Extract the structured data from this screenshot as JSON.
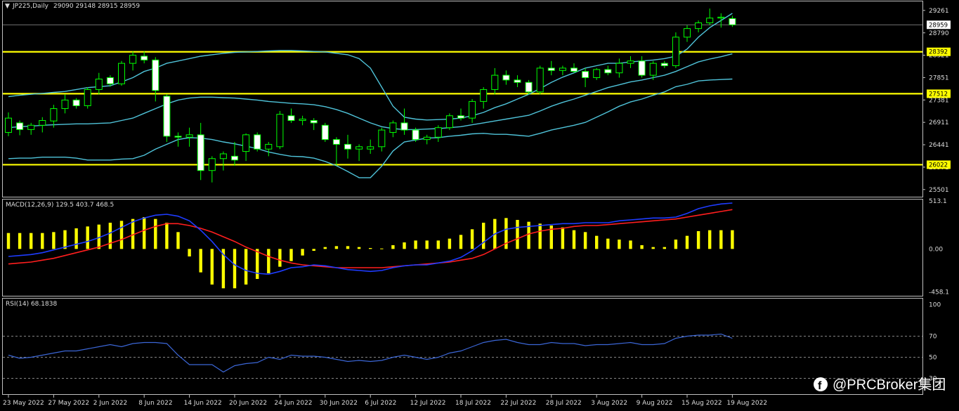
{
  "header": {
    "symbol_label": "JP225,Daily",
    "ohlc_label": "29090 29148 28915 28959"
  },
  "colors": {
    "background": "#000000",
    "grid": "#c0c0c0",
    "candle_up": "#000000",
    "candle_down": "#ffffff",
    "candle_outline": "#00ff00",
    "band": "#4fc3d9",
    "level_line": "#ffff00",
    "macd_hist": "#ffff00",
    "macd_line": "#1e3cff",
    "signal_line": "#ff1e1e",
    "rsi_line": "#3b66d6",
    "price_tag_bg": "#ffffff",
    "level_tag_bg": "#ffff00"
  },
  "watermark": {
    "icon": "facebook-icon",
    "text": "@PRCBroker集团"
  },
  "chart_data": [
    {
      "type": "candlestick",
      "title": "JP225,Daily",
      "ylim": [
        25350,
        29450
      ],
      "price_axis_ticks": [
        "29261",
        "28790",
        "28321",
        "27851",
        "27381",
        "26911",
        "26441",
        "25971",
        "25501"
      ],
      "current_price": "28959",
      "levels": [
        {
          "value": 28392,
          "label": "28392"
        },
        {
          "value": 27512,
          "label": "27512"
        },
        {
          "value": 26022,
          "label": "26022"
        }
      ],
      "x_labels": [
        "23 May 2022",
        "27 May 2022",
        "2 Jun 2022",
        "8 Jun 2022",
        "14 Jun 2022",
        "20 Jun 2022",
        "24 Jun 2022",
        "30 Jun 2022",
        "6 Jul 2022",
        "12 Jul 2022",
        "18 Jul 2022",
        "22 Jul 2022",
        "28 Jul 2022",
        "3 Aug 2022",
        "9 Aug 2022",
        "15 Aug 2022",
        "19 Aug 2022"
      ],
      "x_label_index": [
        0,
        4,
        8,
        12,
        16,
        20,
        24,
        28,
        32,
        36,
        40,
        44,
        48,
        52,
        56,
        60,
        64
      ],
      "candles": [
        [
          26700,
          27120,
          26620,
          27000
        ],
        [
          26900,
          26950,
          26640,
          26760
        ],
        [
          26760,
          26900,
          26650,
          26850
        ],
        [
          26850,
          27020,
          26700,
          26950
        ],
        [
          26940,
          27280,
          26800,
          27200
        ],
        [
          27200,
          27500,
          27100,
          27380
        ],
        [
          27380,
          27420,
          27200,
          27260
        ],
        [
          27260,
          27650,
          27200,
          27600
        ],
        [
          27600,
          27950,
          27500,
          27820
        ],
        [
          27850,
          27900,
          27660,
          27720
        ],
        [
          27720,
          28200,
          27680,
          28150
        ],
        [
          28150,
          28400,
          28000,
          28320
        ],
        [
          28300,
          28400,
          28150,
          28220
        ],
        [
          28220,
          28280,
          27350,
          27580
        ],
        [
          27460,
          27500,
          26500,
          26620
        ],
        [
          26620,
          26700,
          26400,
          26600
        ],
        [
          26600,
          26800,
          26400,
          26650
        ],
        [
          26650,
          26900,
          25700,
          25900
        ],
        [
          25900,
          26200,
          25650,
          26150
        ],
        [
          26150,
          26300,
          25900,
          26250
        ],
        [
          26200,
          26500,
          26000,
          26120
        ],
        [
          26300,
          26680,
          26100,
          26650
        ],
        [
          26650,
          26700,
          26300,
          26350
        ],
        [
          26350,
          26500,
          26200,
          26450
        ],
        [
          26400,
          27150,
          26350,
          27080
        ],
        [
          27050,
          27200,
          26900,
          26950
        ],
        [
          26950,
          27050,
          26850,
          26980
        ],
        [
          26950,
          27000,
          26750,
          26900
        ],
        [
          26850,
          26900,
          26500,
          26550
        ],
        [
          26550,
          26600,
          26000,
          26450
        ],
        [
          26450,
          26650,
          26150,
          26350
        ],
        [
          26350,
          26450,
          26100,
          26400
        ],
        [
          26350,
          26550,
          26250,
          26400
        ],
        [
          26400,
          26800,
          26300,
          26750
        ],
        [
          26700,
          26950,
          26600,
          26900
        ],
        [
          26900,
          27200,
          26650,
          26750
        ],
        [
          26750,
          26800,
          26500,
          26550
        ],
        [
          26550,
          26650,
          26450,
          26600
        ],
        [
          26600,
          26850,
          26500,
          26800
        ],
        [
          26800,
          27100,
          26750,
          27050
        ],
        [
          27050,
          27200,
          26950,
          27000
        ],
        [
          27000,
          27400,
          26900,
          27350
        ],
        [
          27350,
          27650,
          27200,
          27600
        ],
        [
          27600,
          28050,
          27500,
          27900
        ],
        [
          27900,
          28000,
          27700,
          27800
        ],
        [
          27800,
          27900,
          27650,
          27750
        ],
        [
          27750,
          27800,
          27500,
          27550
        ],
        [
          27550,
          28100,
          27500,
          28050
        ],
        [
          28050,
          28200,
          27900,
          28000
        ],
        [
          28000,
          28100,
          27900,
          28050
        ],
        [
          28050,
          28150,
          27950,
          27980
        ],
        [
          27980,
          28050,
          27650,
          27850
        ],
        [
          27850,
          28050,
          27800,
          28020
        ],
        [
          28020,
          28100,
          27900,
          27950
        ],
        [
          27950,
          28250,
          27850,
          28150
        ],
        [
          28150,
          28300,
          28050,
          28200
        ],
        [
          28200,
          28300,
          27850,
          27900
        ],
        [
          27900,
          28200,
          27800,
          28150
        ],
        [
          28150,
          28200,
          28050,
          28100
        ],
        [
          28100,
          28800,
          28050,
          28700
        ],
        [
          28700,
          28950,
          28600,
          28880
        ],
        [
          28880,
          29050,
          28800,
          29000
        ],
        [
          29000,
          29300,
          28950,
          29100
        ],
        [
          29100,
          29200,
          28900,
          29120
        ],
        [
          29090,
          29148,
          28915,
          28959
        ]
      ],
      "bollinger": {
        "upper": [
          27450,
          27480,
          27500,
          27520,
          27540,
          27560,
          27600,
          27640,
          27660,
          27680,
          27760,
          27850,
          27980,
          28050,
          28150,
          28200,
          28250,
          28300,
          28330,
          28360,
          28380,
          28390,
          28400,
          28410,
          28420,
          28420,
          28410,
          28400,
          28390,
          28360,
          28330,
          28250,
          28050,
          27650,
          27250,
          27020,
          26980,
          26960,
          26970,
          26980,
          27000,
          27050,
          27120,
          27220,
          27300,
          27400,
          27500,
          27620,
          27750,
          27860,
          27950,
          28050,
          28100,
          28150,
          28150,
          28180,
          28200,
          28220,
          28250,
          28300,
          28450,
          28700,
          28900,
          29050,
          29200
        ],
        "middle": [
          26800,
          26820,
          26830,
          26850,
          26860,
          26870,
          26880,
          26880,
          26890,
          26900,
          26950,
          27000,
          27100,
          27200,
          27300,
          27380,
          27420,
          27440,
          27440,
          27430,
          27420,
          27400,
          27380,
          27350,
          27330,
          27310,
          27300,
          27280,
          27240,
          27180,
          27100,
          27000,
          26900,
          26820,
          26780,
          26760,
          26760,
          26770,
          26780,
          26800,
          26820,
          26860,
          26900,
          26940,
          26980,
          27020,
          27060,
          27150,
          27250,
          27330,
          27400,
          27480,
          27560,
          27640,
          27700,
          27760,
          27800,
          27850,
          27900,
          27980,
          28080,
          28180,
          28240,
          28290,
          28350
        ],
        "lower": [
          26150,
          26160,
          26160,
          26180,
          26180,
          26180,
          26160,
          26120,
          26120,
          26120,
          26140,
          26150,
          26220,
          26350,
          26450,
          26550,
          26590,
          26580,
          26550,
          26500,
          26460,
          26410,
          26360,
          26290,
          26240,
          26200,
          26190,
          26160,
          26090,
          26000,
          25880,
          25750,
          25750,
          25990,
          26310,
          26500,
          26540,
          26580,
          26590,
          26620,
          26640,
          26670,
          26680,
          26660,
          26660,
          26640,
          26620,
          26680,
          26750,
          26800,
          26850,
          26910,
          27020,
          27130,
          27250,
          27340,
          27400,
          27480,
          27550,
          27660,
          27710,
          27780,
          27800,
          27810,
          27820
        ]
      }
    },
    {
      "type": "bar",
      "title": "MACD(12,26,9) 129.5 403.7 468.5",
      "ylim": [
        -500,
        520
      ],
      "axis_ticks": [
        "513.1",
        "0.00",
        "-458.1"
      ],
      "histogram": [
        170,
        170,
        170,
        170,
        180,
        200,
        220,
        240,
        260,
        280,
        300,
        320,
        340,
        320,
        280,
        180,
        -80,
        -250,
        -380,
        -420,
        -420,
        -380,
        -320,
        -260,
        -190,
        -130,
        -70,
        -20,
        20,
        30,
        30,
        20,
        10,
        5,
        40,
        70,
        90,
        90,
        90,
        110,
        150,
        210,
        280,
        320,
        330,
        310,
        290,
        270,
        250,
        230,
        200,
        180,
        140,
        110,
        100,
        90,
        40,
        20,
        20,
        100,
        140,
        190,
        200,
        200,
        200
      ],
      "macd": [
        -80,
        -70,
        -60,
        -40,
        -10,
        20,
        50,
        80,
        120,
        170,
        230,
        290,
        330,
        360,
        370,
        350,
        300,
        200,
        80,
        -60,
        -170,
        -230,
        -260,
        -270,
        -240,
        -200,
        -190,
        -170,
        -180,
        -200,
        -220,
        -230,
        -240,
        -230,
        -200,
        -180,
        -170,
        -170,
        -150,
        -130,
        -90,
        -20,
        70,
        160,
        210,
        230,
        240,
        250,
        260,
        270,
        270,
        280,
        280,
        280,
        300,
        310,
        320,
        330,
        330,
        340,
        380,
        430,
        460,
        480,
        490
      ],
      "signal": [
        -160,
        -150,
        -140,
        -120,
        -100,
        -70,
        -40,
        -10,
        20,
        60,
        100,
        150,
        200,
        240,
        270,
        270,
        250,
        220,
        180,
        130,
        80,
        20,
        -30,
        -80,
        -120,
        -150,
        -170,
        -180,
        -190,
        -200,
        -200,
        -200,
        -200,
        -200,
        -190,
        -180,
        -170,
        -160,
        -150,
        -140,
        -120,
        -100,
        -60,
        0,
        60,
        110,
        160,
        190,
        210,
        220,
        240,
        250,
        250,
        260,
        270,
        280,
        290,
        300,
        310,
        320,
        340,
        360,
        380,
        400,
        420
      ]
    },
    {
      "type": "line",
      "title": "RSI(14) 68.1838",
      "ylim": [
        15,
        105
      ],
      "axis_ticks": [
        "100",
        "70",
        "50",
        "30"
      ],
      "reference_levels": [
        70,
        50,
        30
      ],
      "values": [
        52,
        49,
        50,
        52,
        54,
        56,
        56,
        58,
        60,
        62,
        60,
        63,
        64,
        64,
        63,
        52,
        43,
        43,
        43,
        36,
        42,
        44,
        45,
        50,
        48,
        52,
        51,
        51,
        50,
        48,
        46,
        47,
        46,
        47,
        50,
        52,
        50,
        48,
        50,
        54,
        56,
        60,
        64,
        66,
        67,
        64,
        62,
        62,
        64,
        63,
        63,
        61,
        62,
        62,
        63,
        64,
        62,
        62,
        63,
        68,
        70,
        71,
        71,
        72,
        68
      ]
    }
  ]
}
